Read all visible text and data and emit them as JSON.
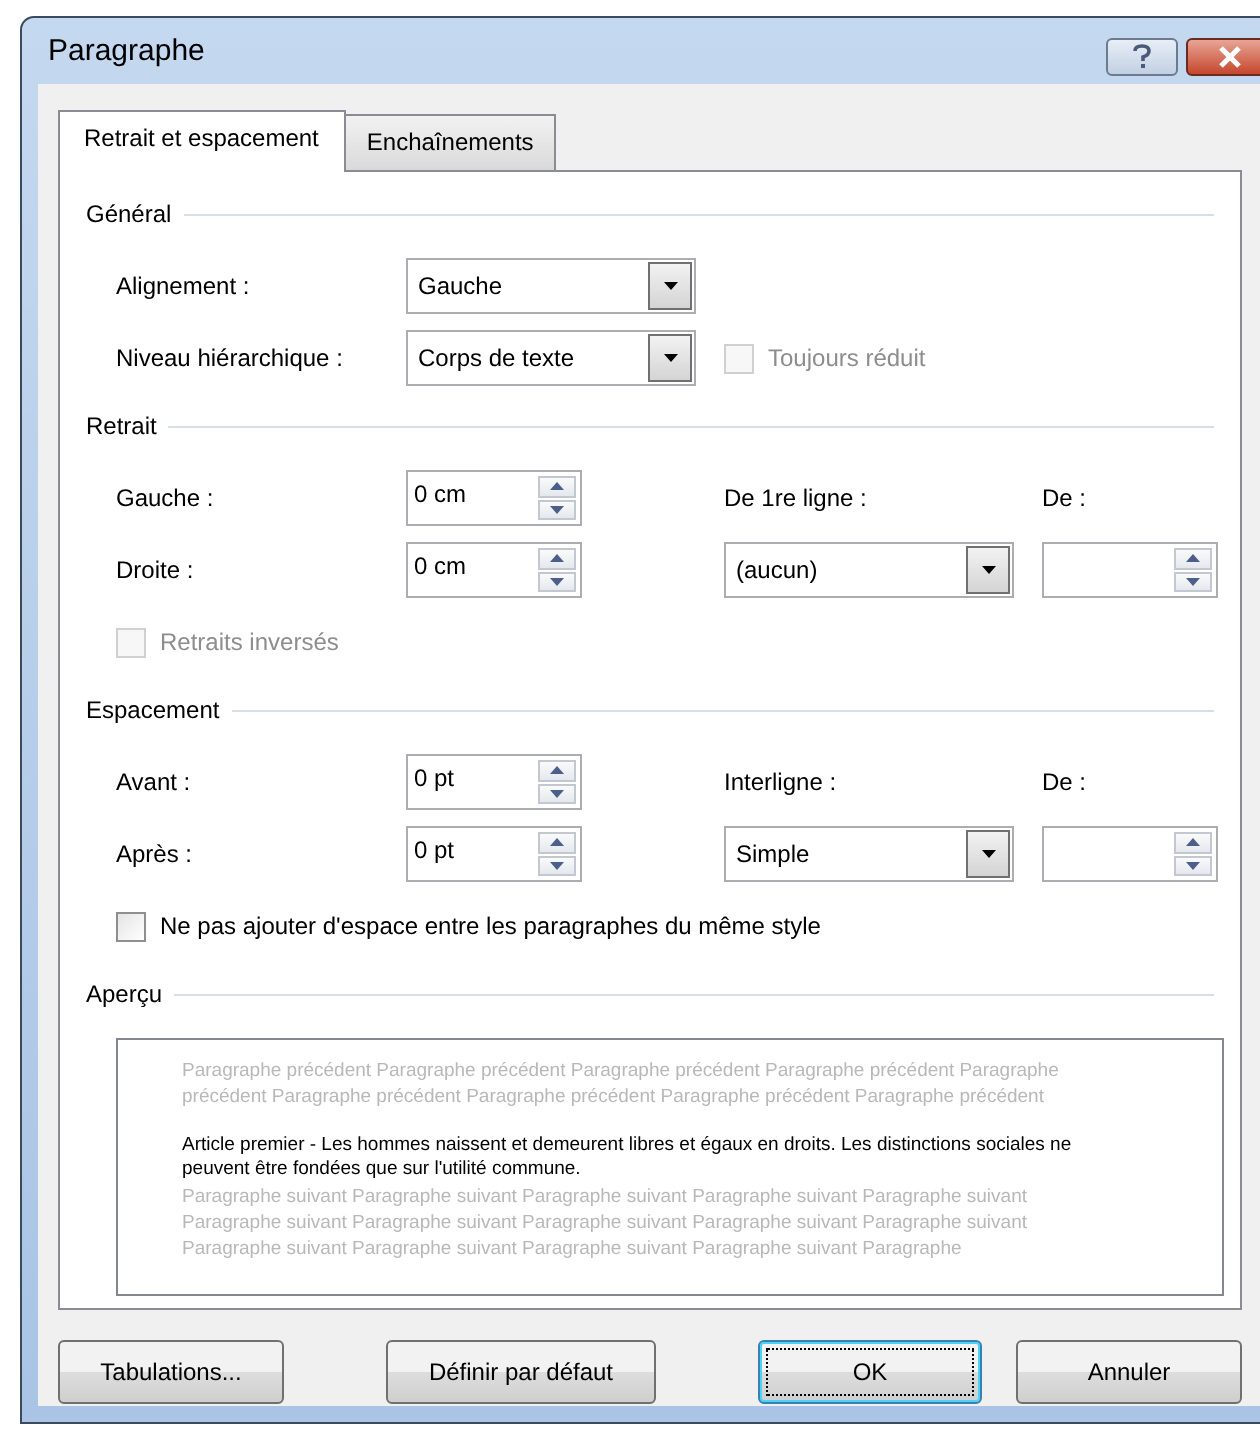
{
  "window": {
    "title": "Paragraphe"
  },
  "tabs": [
    {
      "label": "Retrait et espacement",
      "selected": true
    },
    {
      "label": "Enchaînements",
      "selected": false
    }
  ],
  "sections": [
    {
      "title": "Général",
      "rows": [
        {
          "items": [
            {
              "kind": "label",
              "text": "Alignement :"
            },
            {
              "kind": "dropdown",
              "value": "Gauche"
            }
          ]
        },
        {
          "items": [
            {
              "kind": "label",
              "text": "Niveau hiérarchique :"
            },
            {
              "kind": "dropdown",
              "value": "Corps de texte"
            },
            {
              "kind": "checkbox",
              "text": "Toujours réduit",
              "checked": false,
              "disabled": true
            }
          ]
        }
      ]
    },
    {
      "title": "Retrait",
      "rows": [
        {
          "items": [
            {
              "kind": "label",
              "text": "Gauche :"
            },
            {
              "kind": "spin",
              "value": "0 cm"
            },
            {
              "kind": "label",
              "text": "De 1re ligne :"
            },
            {
              "kind": "label",
              "text": "De :"
            }
          ]
        },
        {
          "items": [
            {
              "kind": "label",
              "text": "Droite :"
            },
            {
              "kind": "spin",
              "value": "0 cm"
            },
            {
              "kind": "dropdown",
              "value": "(aucun)"
            },
            {
              "kind": "spin"
            }
          ]
        },
        {
          "items": [
            {
              "kind": "checkbox",
              "text": "Retraits inversés",
              "checked": false,
              "disabled": true
            }
          ]
        }
      ]
    },
    {
      "title": "Espacement",
      "rows": [
        {
          "items": [
            {
              "kind": "label",
              "text": "Avant :"
            },
            {
              "kind": "spin",
              "value": "0 pt"
            },
            {
              "kind": "label",
              "text": "Interligne :"
            },
            {
              "kind": "label",
              "text": "De :"
            }
          ]
        },
        {
          "items": [
            {
              "kind": "label",
              "text": "Après :"
            },
            {
              "kind": "spin",
              "value": "0 pt"
            },
            {
              "kind": "dropdown",
              "value": "Simple"
            },
            {
              "kind": "spin"
            }
          ]
        },
        {
          "items": [
            {
              "kind": "checkbox",
              "text": "Ne pas ajouter d'espace entre les paragraphes du même style",
              "checked": false,
              "disabled": false
            }
          ]
        }
      ]
    }
  ],
  "preview": {
    "title": "Aperçu",
    "before": "Paragraphe précédent Paragraphe précédent Paragraphe précédent Paragraphe précédent Paragraphe précédent Paragraphe précédent Paragraphe précédent Paragraphe précédent Paragraphe précédent",
    "current": "Article premier - Les hommes naissent et demeurent libres et égaux en droits. Les distinctions sociales ne peuvent être fondées que sur l'utilité commune.",
    "after": "Paragraphe suivant Paragraphe suivant Paragraphe suivant Paragraphe suivant Paragraphe suivant Paragraphe suivant Paragraphe suivant Paragraphe suivant Paragraphe suivant Paragraphe suivant Paragraphe suivant Paragraphe suivant Paragraphe suivant Paragraphe suivant Paragraphe"
  },
  "buttons": [
    {
      "label": "Tabulations...",
      "default": false
    },
    {
      "label": "Définir par défaut",
      "default": false
    },
    {
      "label": "OK",
      "default": true
    },
    {
      "label": "Annuler",
      "default": false
    }
  ]
}
